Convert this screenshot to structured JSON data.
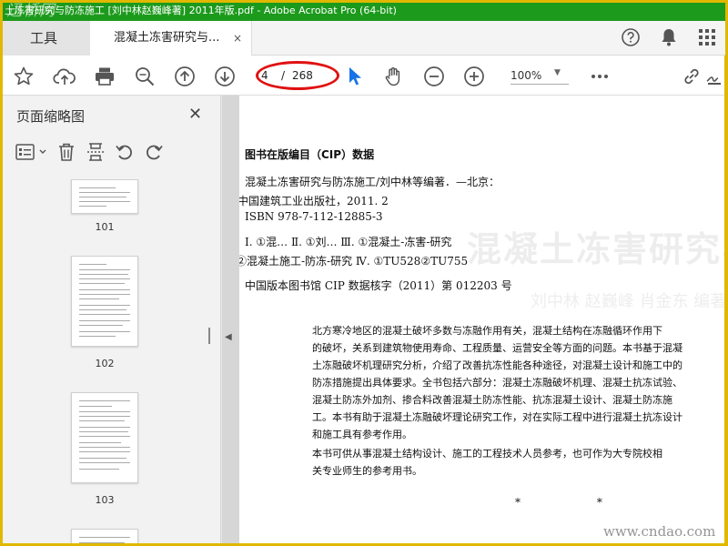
{
  "window": {
    "title": "土冻害研究与防冻施工 [刘中林赵巍峰著] 2011年版.pdf - Adobe Acrobat Pro (64-bit)",
    "watermark": "迅桥网"
  },
  "tabs": {
    "tools_label": "工具",
    "doc_label": "混凝土冻害研究与...",
    "close_glyph": "×"
  },
  "toolbar": {
    "page_current": "4",
    "page_separator": "/",
    "page_total": "268",
    "zoom_value": "100%"
  },
  "sidepanel": {
    "title": "页面缩略图",
    "thumbnails": [
      {
        "label": "101"
      },
      {
        "label": "102"
      },
      {
        "label": "103"
      }
    ]
  },
  "document": {
    "ghost_title": "混凝土冻害研究与防冻施工",
    "ghost_authors": "刘中林  赵巍峰  肖金东  编著",
    "cip_heading": "图书在版编目（CIP）数据",
    "cip_lines": [
      "混凝土冻害研究与防冻施工/刘中林等编著．—北京：",
      "中国建筑工业出版社，2011. 2",
      "ISBN 978-7-112-12885-3",
      "Ⅰ. ①混…   Ⅱ. ①刘…   Ⅲ. ①混凝土-冻害-研究",
      "②混凝土施工-防冻-研究    Ⅳ. ①TU528②TU755",
      "中国版本图书馆 CIP 数据核字（2011）第 012203 号"
    ],
    "paragraph_lines": [
      "    北方寒冷地区的混凝土破坏多数与冻融作用有关，混凝土结构在冻融循环作用下",
      "的破坏，关系到建筑物使用寿命、工程质量、运营安全等方面的问题。本书基于混凝",
      "土冻融破坏机理研究分析，介绍了改善抗冻性能各种途径，对混凝土设计和施工中的",
      "防冻措施提出具体要求。全书包括六部分：混凝土冻融破坏机理、混凝土抗冻试验、",
      "混凝土防冻外加剂、掺合料改善混凝土防冻性能、抗冻混凝土设计、混凝土防冻施",
      "工。本书有助于混凝土冻融破坏理论研究工作，对在实际工程中进行混凝土抗冻设计",
      "和施工具有参考作用。",
      "    本书可供从事混凝土结构设计、施工的工程技术人员参考，也可作为大专院校相",
      "关专业师生的参考用书。"
    ],
    "stars": "* *"
  },
  "site_watermark": "www.cndao.com",
  "colors": {
    "titlebar": "#1c9a1c",
    "accent_blue": "#1473e6",
    "highlight_red": "#e01010",
    "frame_yellow": "#e0b800"
  },
  "icons": [
    "star-icon",
    "cloud-upload-icon",
    "print-icon",
    "zoom-search-icon",
    "page-up-icon",
    "page-down-icon",
    "select-arrow-icon",
    "hand-icon",
    "zoom-out-icon",
    "zoom-in-icon",
    "more-icon",
    "link-icon",
    "sign-icon",
    "help-icon",
    "bell-icon",
    "apps-grid-icon"
  ]
}
